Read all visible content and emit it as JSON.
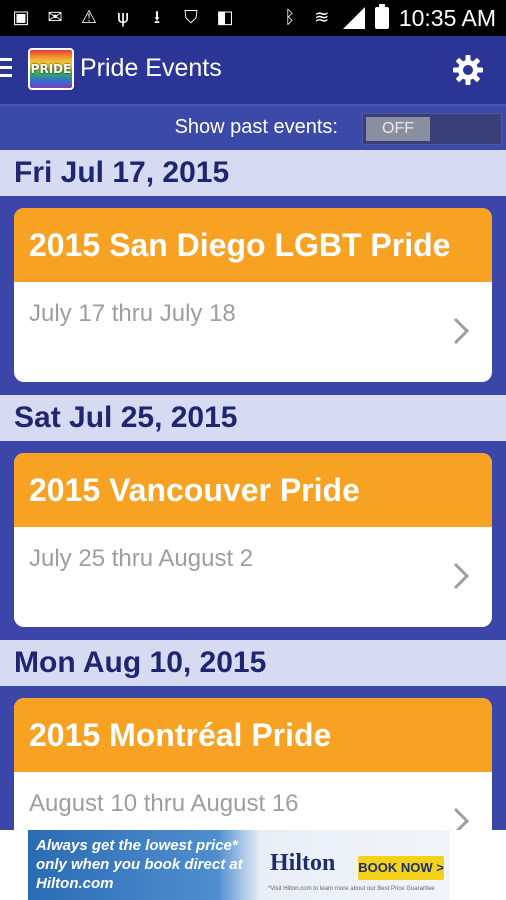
{
  "status_bar": {
    "time": "10:35 AM",
    "icons": [
      "photo-icon",
      "mail-icon",
      "warning-icon",
      "usb-icon",
      "download-icon",
      "shield-icon",
      "flipboard-icon",
      "bluetooth-icon",
      "wifi-icon",
      "signal-icon",
      "battery-icon"
    ]
  },
  "app_bar": {
    "logo_text": "PRIDE",
    "title": "Pride Events",
    "settings_icon": "gear-icon",
    "menu_icon": "menu-icon"
  },
  "filter": {
    "label": "Show past events:",
    "toggle_state": "OFF"
  },
  "events": [
    {
      "date_header": "Fri Jul 17, 2015",
      "title": "2015 San Diego LGBT Pride",
      "dates": "July 17 thru July 18"
    },
    {
      "date_header": "Sat Jul 25, 2015",
      "title": "2015 Vancouver Pride",
      "dates": "July 25 thru August 2"
    },
    {
      "date_header": "Mon Aug 10, 2015",
      "title": "2015 Montréal Pride",
      "dates": "August 10 thru August 16"
    }
  ],
  "ad": {
    "text": "Always get the lowest price* only when you book direct at Hilton.com",
    "brand": "Hilton",
    "cta": "BOOK NOW >",
    "fine_print": "*Visit Hilton.com to learn more about our Best Price Guarantee"
  },
  "colors": {
    "app_bar": "#2a3595",
    "background": "#3c46a8",
    "date_header_bg": "#d7dbf2",
    "card_title_bg": "#f7a223",
    "date_text": "#9e9e9e"
  }
}
